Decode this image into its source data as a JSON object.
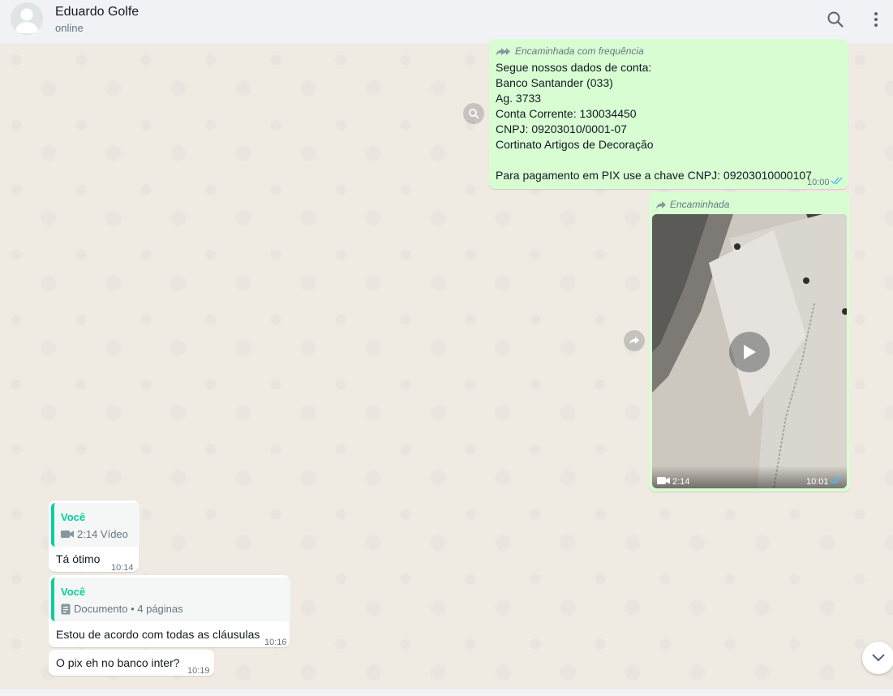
{
  "header": {
    "contact_name": "Eduardo Golfe",
    "status": "online"
  },
  "messages": {
    "m1": {
      "forward_label": "Encaminhada com frequência",
      "lines": [
        "Segue nossos dados de conta:",
        "Banco Santander (033)",
        "Ag. 3733",
        "Conta Corrente: 130034450",
        "CNPJ: 09203010/0001-07",
        "Cortinato Artigos de Decoração",
        "",
        "Para pagamento em PIX use a chave CNPJ: 09203010000107"
      ],
      "time": "10:00"
    },
    "m2": {
      "forward_label": "Encaminhada",
      "duration": "2:14",
      "time": "10:01"
    },
    "m3": {
      "quote_author": "Você",
      "quote_text": "2:14 Vídeo",
      "text": "Tá ótimo",
      "time": "10:14"
    },
    "m4": {
      "quote_author": "Você",
      "quote_text": "Documento • 4 páginas",
      "text": "Estou de acordo com todas as cláusulas",
      "time": "10:16"
    },
    "m5": {
      "text": "O pix eh no banco inter?",
      "time": "10:19"
    }
  },
  "icons": {
    "search": "search-icon",
    "menu": "menu-icon",
    "forward": "forward-icon",
    "double_check": "double-check-icon",
    "play": "play-icon",
    "video_camera": "video-camera-icon",
    "document": "document-icon",
    "chevron_down": "chevron-down-icon"
  },
  "colors": {
    "outgoing_bubble": "#d9fdd3",
    "incoming_bubble": "#ffffff",
    "quote_accent": "#06cf9c",
    "read_ticks": "#53bdeb"
  }
}
